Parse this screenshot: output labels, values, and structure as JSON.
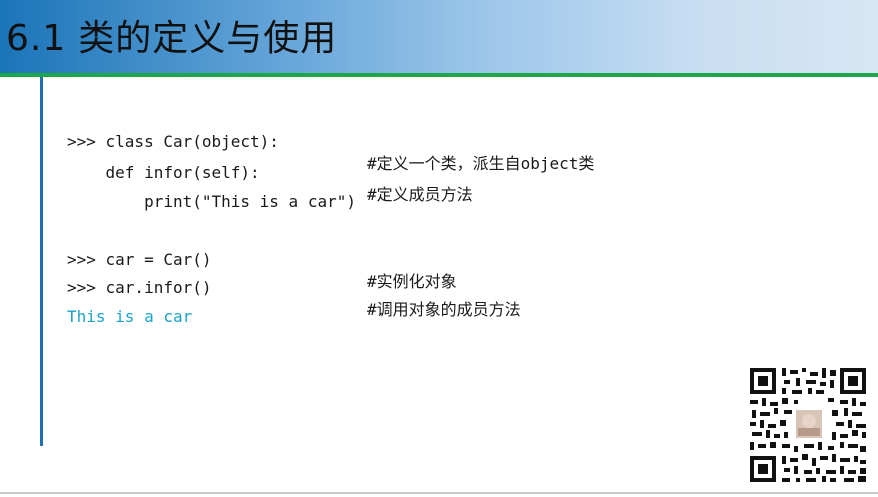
{
  "slide": {
    "section_number": "6.1",
    "title": "类的定义与使用"
  },
  "code_lines": [
    {
      "code": ">>> class Car(object):",
      "comment": "#定义一个类，派生自object类"
    },
    {
      "code": "    def infor(self):",
      "comment": "#定义成员方法"
    },
    {
      "code": "        print(\"This is a car\")",
      "comment": ""
    },
    {
      "code": ">>> car = Car()",
      "comment": "#实例化对象"
    },
    {
      "code": ">>> car.infor()",
      "comment": "#调用对象的成员方法"
    }
  ],
  "output_line": "This is a car",
  "colors": {
    "header_dark": "#1b74b8",
    "header_light": "#d7e6f4",
    "green_rule": "#1da64a",
    "left_bar": "#1f6fb2",
    "output_text": "#1aa3c8"
  },
  "icons": [
    "qr-code-icon"
  ]
}
